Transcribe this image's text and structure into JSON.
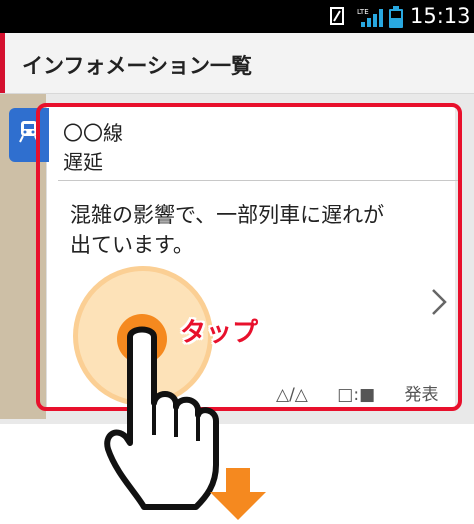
{
  "status_bar": {
    "time": "15:13",
    "network": "LTE",
    "icons": [
      "sim-icon",
      "lte-signal-icon",
      "battery-icon"
    ]
  },
  "header": {
    "title": "インフォメーション一覧",
    "accent_color": "#d4102e"
  },
  "info_item": {
    "category_icon": "train-icon",
    "line_name": "〇〇線",
    "status": "遅延",
    "message": "混雑の影響で、一部列車に遅れが出ています。",
    "time_placeholder": "△/△",
    "clock_placeholder": "□:■",
    "announced_label": "発表"
  },
  "annotation": {
    "tap_label": "タップ",
    "highlight_color": "#e8102c",
    "tap_color": "#f5891f"
  }
}
